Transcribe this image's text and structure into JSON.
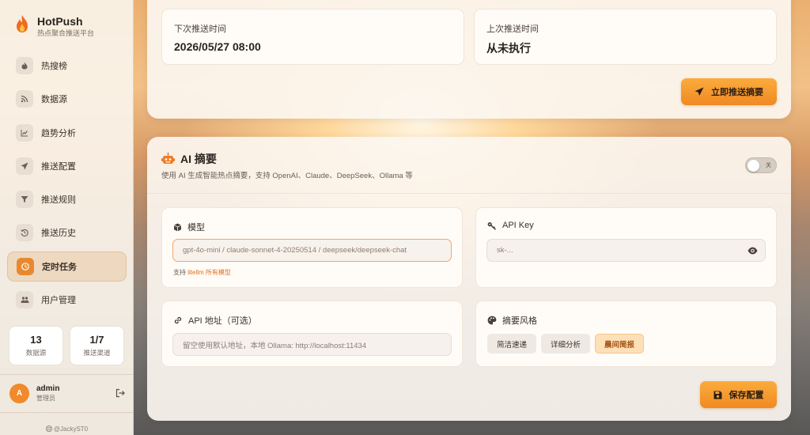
{
  "app": {
    "title": "HotPush",
    "subtitle": "热点聚合推送平台"
  },
  "sidebar": {
    "items": [
      {
        "label": "热搜榜",
        "icon": "fire-icon"
      },
      {
        "label": "数据源",
        "icon": "rss-icon"
      },
      {
        "label": "趋势分析",
        "icon": "chart-line-icon"
      },
      {
        "label": "推送配置",
        "icon": "send-icon"
      },
      {
        "label": "推送规则",
        "icon": "filter-icon"
      },
      {
        "label": "推送历史",
        "icon": "history-icon"
      },
      {
        "label": "定时任务",
        "icon": "clock-icon",
        "active": true
      },
      {
        "label": "用户管理",
        "icon": "users-icon"
      }
    ],
    "stats": [
      {
        "value": "13",
        "label": "数据源"
      },
      {
        "value": "1/7",
        "label": "推送渠道"
      }
    ],
    "user": {
      "initial": "A",
      "name": "admin",
      "role": "管理员"
    },
    "footer": "@JackyST0"
  },
  "schedule": {
    "next_label": "下次推送时间",
    "next_value": "2026/05/27 08:00",
    "last_label": "上次推送时间",
    "last_value": "从未执行",
    "push_now_label": "立即推送摘要"
  },
  "ai": {
    "title": "AI 摘要",
    "description": "使用 AI 生成智能热点摘要，支持 OpenAI、Claude、DeepSeek、Ollama 等",
    "toggle_label": "关",
    "toggle_on": false,
    "model": {
      "label": "模型",
      "placeholder": "gpt-4o-mini / claude-sonnet-4-20250514 / deepseek/deepseek-chat",
      "hint_prefix": "支持 ",
      "hint_link": "litellm 所有模型"
    },
    "api_key": {
      "label": "API Key",
      "placeholder": "sk-..."
    },
    "api_url": {
      "label": "API 地址（可选）",
      "placeholder": "留空使用默认地址，本地 Ollama: http://localhost:11434"
    },
    "style": {
      "label": "摘要风格",
      "options": [
        "简洁速递",
        "详细分析",
        "晨间简报"
      ],
      "selected": "晨间简报"
    },
    "save_label": "保存配置"
  },
  "colors": {
    "accent": "#f08a24",
    "accent_light": "#fbab3c",
    "selected_chip": "#fde0b8"
  }
}
